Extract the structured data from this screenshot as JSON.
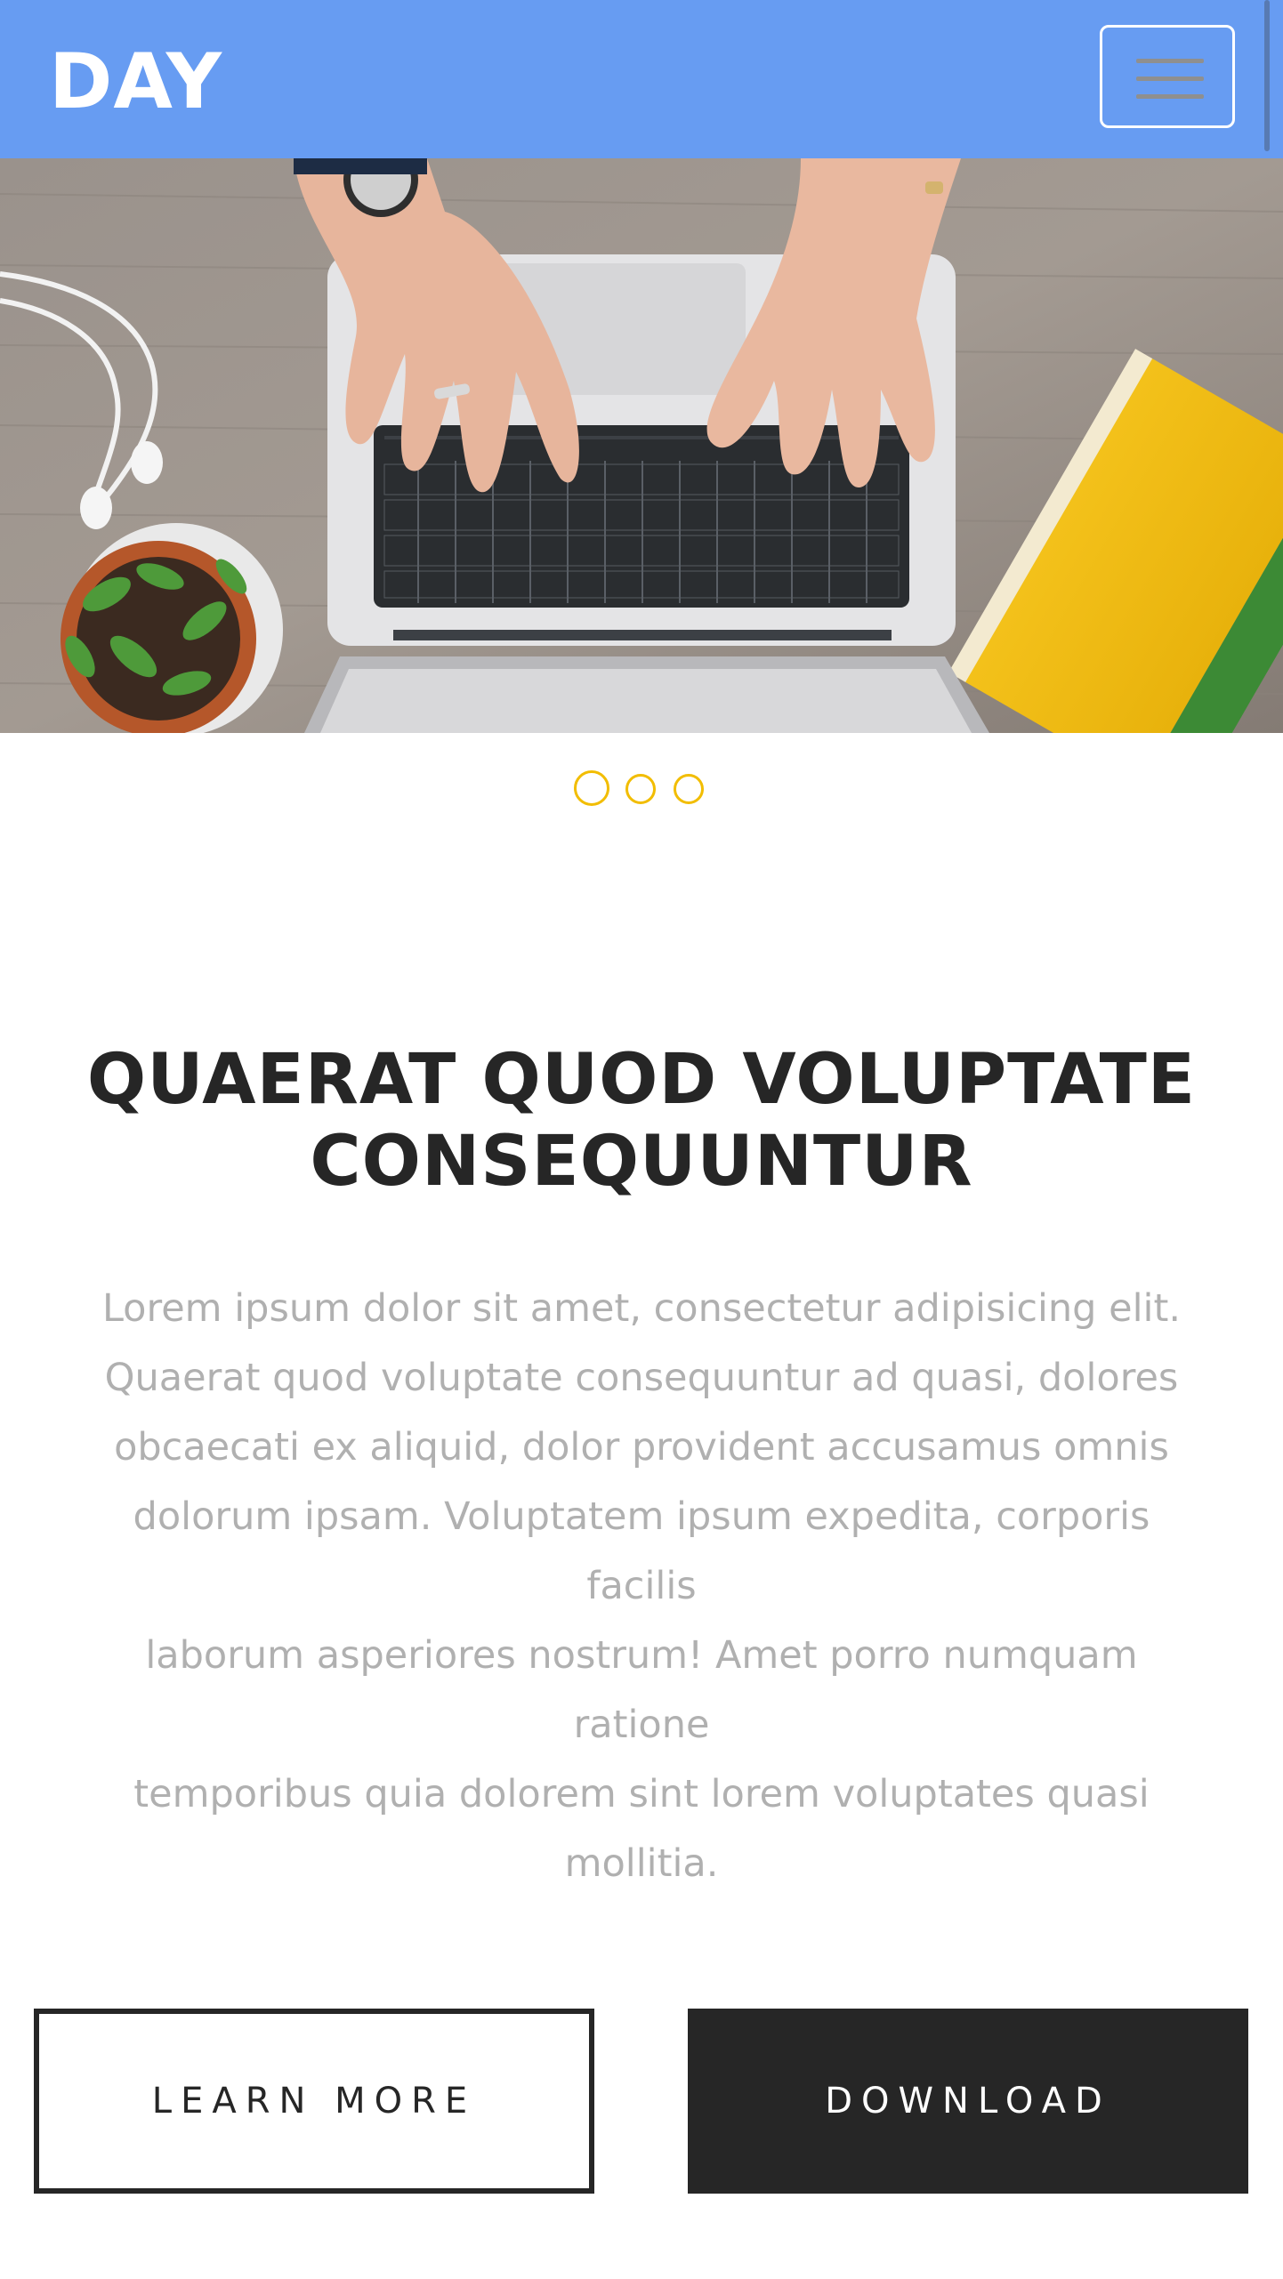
{
  "header": {
    "brand": "DAY",
    "menu_icon": "hamburger-icon",
    "background_color": "#679cf2"
  },
  "hero": {
    "image_description_icon": "laptop-hands-photo"
  },
  "carousel": {
    "indicator_count": 3,
    "active_index": 0,
    "indicator_color": "#f2bd00"
  },
  "main": {
    "headline_line1": "QUAERAT QUOD VOLUPTATE",
    "headline_line2": "CONSEQUUNTUR",
    "body_lines": [
      "Lorem ipsum dolor sit amet, consectetur adipisicing elit.",
      "Quaerat quod voluptate consequuntur ad quasi, dolores",
      "obcaecati ex aliquid, dolor provident accusamus omnis",
      "dolorum ipsam. Voluptatem ipsum expedita, corporis facilis",
      "laborum asperiores nostrum! Amet porro numquam ratione",
      "temporibus quia dolorem sint lorem voluptates quasi",
      "mollitia."
    ]
  },
  "actions": {
    "learn_more_label": "LEARN MORE",
    "download_label": "DOWNLOAD",
    "dark_color": "#262626"
  }
}
